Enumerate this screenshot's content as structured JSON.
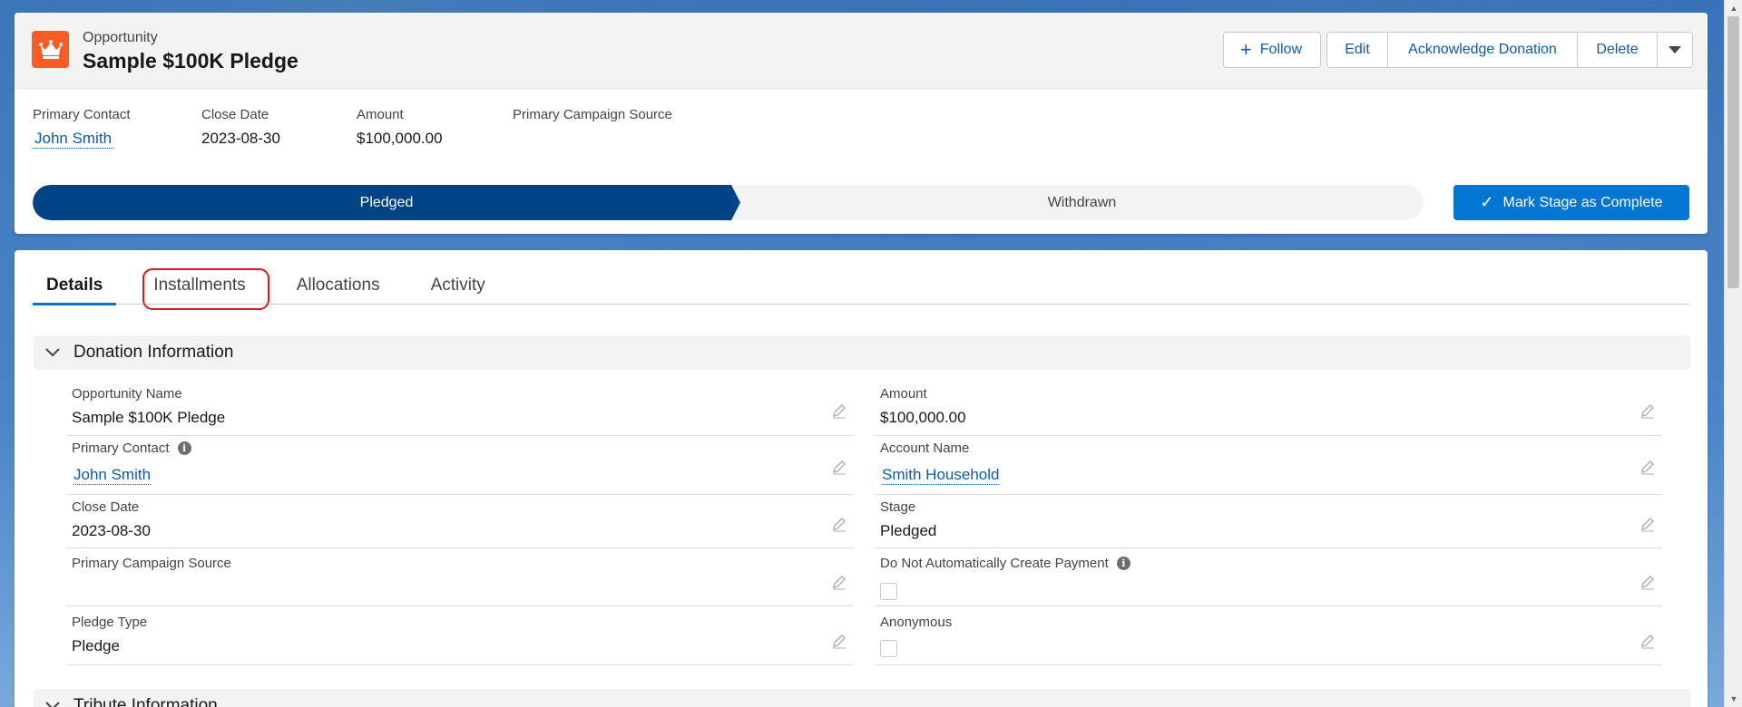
{
  "record": {
    "type_label": "Opportunity",
    "title": "Sample $100K Pledge",
    "icon": "crown-icon",
    "icon_color": "#fc5c23"
  },
  "actions": {
    "follow_label": "Follow",
    "edit_label": "Edit",
    "acknowledge_label": "Acknowledge Donation",
    "delete_label": "Delete"
  },
  "highlights": {
    "primary_contact": {
      "label": "Primary Contact",
      "value": "John Smith"
    },
    "close_date": {
      "label": "Close Date",
      "value": "2023-08-30"
    },
    "amount": {
      "label": "Amount",
      "value": "$100,000.00"
    },
    "campaign_source": {
      "label": "Primary Campaign Source",
      "value": ""
    }
  },
  "path": {
    "current": "Pledged",
    "next": "Withdrawn",
    "mark_complete_label": "Mark Stage as Complete"
  },
  "tabs": [
    {
      "label": "Details",
      "active": true
    },
    {
      "label": "Installments",
      "active": false,
      "highlighted": true
    },
    {
      "label": "Allocations",
      "active": false
    },
    {
      "label": "Activity",
      "active": false
    }
  ],
  "sections": {
    "donation_information": "Donation Information",
    "tribute_information": "Tribute Information"
  },
  "fields": {
    "opportunity_name": {
      "label": "Opportunity Name",
      "value": "Sample $100K Pledge"
    },
    "amount": {
      "label": "Amount",
      "value": "$100,000.00"
    },
    "primary_contact": {
      "label": "Primary Contact",
      "value": "John Smith"
    },
    "account_name": {
      "label": "Account Name",
      "value": "Smith Household"
    },
    "close_date": {
      "label": "Close Date",
      "value": "2023-08-30"
    },
    "stage": {
      "label": "Stage",
      "value": "Pledged"
    },
    "primary_campaign_source": {
      "label": "Primary Campaign Source",
      "value": ""
    },
    "do_not_create_payment": {
      "label": "Do Not Automatically Create Payment",
      "checked": false
    },
    "pledge_type": {
      "label": "Pledge Type",
      "value": "Pledge"
    },
    "anonymous": {
      "label": "Anonymous",
      "checked": false
    }
  },
  "colors": {
    "brand_blue": "#0176d3",
    "path_current": "#014486",
    "link": "#0b5cab",
    "annotation_red": "#e3151a"
  }
}
